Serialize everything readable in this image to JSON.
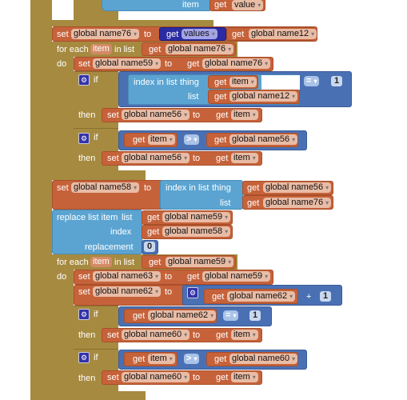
{
  "colors": {
    "control": "#a68a40",
    "variable": "#c6623a",
    "list": "#5ba4d1",
    "math_logic": "#4a70b4",
    "procedure_arg": "#2c2ca2"
  },
  "dropdown_icon": "▾",
  "gear_icon": "⚙",
  "top": {
    "label": "item",
    "get": "get",
    "var": "value"
  },
  "s76": {
    "set": "set",
    "var": "global name76",
    "to": "to",
    "get": "get",
    "param": "values",
    "get2": "get",
    "var2": "global name12"
  },
  "fe1": {
    "for_each": "for each",
    "item": "item",
    "in_list": "in list",
    "get": "get",
    "var": "global name76",
    "do": "do"
  },
  "s59": {
    "set": "set",
    "var": "global name59",
    "to": "to",
    "get": "get",
    "var2": "global name76"
  },
  "if1": {
    "if": "if",
    "index_in_list": "index in list",
    "thing": "thing",
    "list": "list",
    "get1": "get",
    "var1": "item",
    "get2": "get",
    "var2": "global name12",
    "op": "=",
    "num": "1",
    "then": "then",
    "set": "set",
    "svar": "global name56",
    "to": "to",
    "get3": "get",
    "var3": "item"
  },
  "if2": {
    "if": "if",
    "get1": "get",
    "var1": "item",
    "op": ">",
    "get2": "get",
    "var2": "global name56",
    "then": "then",
    "set": "set",
    "svar": "global name56",
    "to": "to",
    "get3": "get",
    "var3": "item"
  },
  "s58": {
    "set": "set",
    "var": "global name58",
    "to": "to",
    "index_in_list": "index in list",
    "thing": "thing",
    "list": "list",
    "get1": "get",
    "var1": "global name56",
    "get2": "get",
    "var2": "global name76"
  },
  "rep": {
    "label": "replace list item",
    "list": "list",
    "index": "index",
    "replacement": "replacement",
    "get1": "get",
    "var1": "global name59",
    "get2": "get",
    "var2": "global name58",
    "num": "0"
  },
  "fe2": {
    "for_each": "for each",
    "item": "item",
    "in_list": "in list",
    "get": "get",
    "var": "global name59",
    "do": "do"
  },
  "s63": {
    "set": "set",
    "var": "global name63",
    "to": "to",
    "get": "get",
    "var2": "global name59"
  },
  "s62": {
    "set": "set",
    "var": "global name62",
    "to": "to",
    "get": "get",
    "var2": "global name62",
    "op": "+",
    "num": "1"
  },
  "if3": {
    "if": "if",
    "get1": "get",
    "var1": "global name62",
    "op": "=",
    "num": "1",
    "then": "then",
    "set": "set",
    "svar": "global name60",
    "to": "to",
    "get3": "get",
    "var3": "item"
  },
  "if4": {
    "if": "if",
    "get1": "get",
    "var1": "item",
    "op": ">",
    "get2": "get",
    "var2": "global name60",
    "then": "then",
    "set": "set",
    "svar": "global name60",
    "to": "to",
    "get3": "get",
    "var3": "item"
  }
}
